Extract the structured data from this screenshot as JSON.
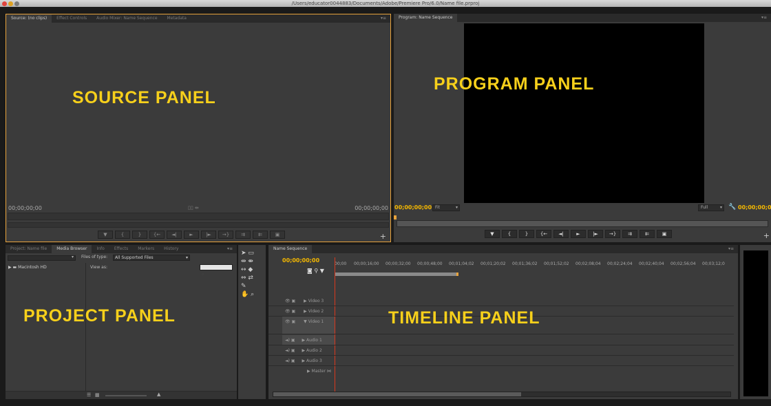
{
  "app": {
    "window_title": "/Users/educator0044883/Documents/Adobe/Premiere Pro/6.0/Name file.prproj"
  },
  "colors": {
    "accent": "#e8a33c",
    "label_yellow": "#f7d01b",
    "timecode": "#f5b800"
  },
  "source": {
    "tabs": [
      "Source: (no clips)",
      "Effect Controls",
      "Audio Mixer: Name Sequence",
      "Metadata"
    ],
    "label": "SOURCE PANEL",
    "timecode_left": "00;00;00;00",
    "timecode_right": "00;00;00;00",
    "buttons": [
      "▼",
      "{",
      "}",
      "{←",
      "◄|",
      "►",
      "|►",
      "→}",
      "⇉",
      "⇇",
      "▣"
    ]
  },
  "program": {
    "tabs": [
      "Program: Name Sequence"
    ],
    "label": "PROGRAM PANEL",
    "timecode_left": "00;00;00;00",
    "fit": "Fit",
    "full": "Full",
    "timecode_right": "00;00;00;0",
    "buttons": [
      "▼",
      "{",
      "}",
      "{←",
      "◄|",
      "►",
      "|►",
      "→}",
      "⇉",
      "⇇",
      "▣"
    ]
  },
  "project": {
    "tabs": [
      "Project: Name file",
      "Media Browser",
      "Info",
      "Effects",
      "Markers",
      "History"
    ],
    "label": "PROJECT PANEL",
    "files_of_type_label": "Files of type:",
    "files_of_type_value": "All Supported Files",
    "view_as": "View as:",
    "tree_item": "Macintosh HD"
  },
  "timeline": {
    "tabs": [
      "Name Sequence"
    ],
    "label": "TIMELINE PANEL",
    "timecode": "00;00;00;00",
    "ruler": [
      "00;00",
      "00;00;16;00",
      "00;00;32;00",
      "00;00;48;00",
      "00;01;04;02",
      "00;01;20;02",
      "00;01;36;02",
      "00;01;52;02",
      "00;02;08;04",
      "00;02;24;04",
      "00;02;40;04",
      "00;02;56;04",
      "00;03;12;0"
    ],
    "tracks": [
      "Video 3",
      "Video 2",
      "Video 1",
      "Audio 1",
      "Audio 2",
      "Audio 3",
      "Master"
    ]
  }
}
